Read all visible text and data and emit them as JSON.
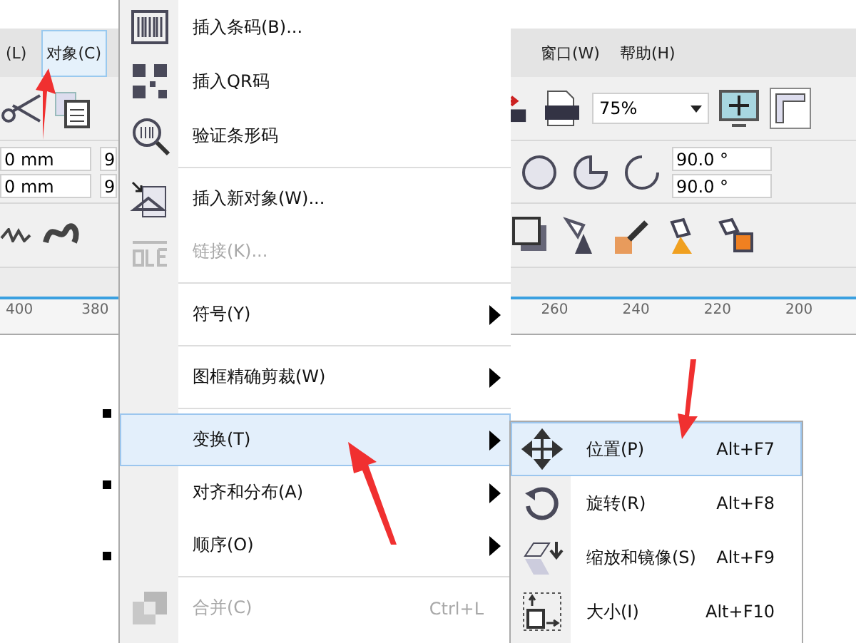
{
  "menubar": {
    "items": [
      {
        "label": "(L)",
        "selected": false
      },
      {
        "label": "对象(C)",
        "selected": true
      },
      {
        "label": "窗口(W)",
        "selected": false
      },
      {
        "label": "帮助(H)",
        "selected": false
      }
    ]
  },
  "toolbar": {
    "zoom": "75%"
  },
  "property_bar": {
    "size_fields": [
      "0 mm",
      "0 mm"
    ],
    "cut_fields": [
      "9",
      "9"
    ],
    "angle_fields": [
      "90.0 °",
      "90.0 °"
    ]
  },
  "ruler": {
    "left_ticks": [
      "400",
      "380"
    ],
    "right_ticks": [
      "260",
      "240",
      "220",
      "200"
    ]
  },
  "menu": {
    "items": [
      {
        "kind": "item",
        "label": "插入条码(B)...",
        "disabled": false,
        "selected": false,
        "submenu": false
      },
      {
        "kind": "item",
        "label": "插入QR码",
        "disabled": false,
        "selected": false,
        "submenu": false
      },
      {
        "kind": "item",
        "label": "验证条形码",
        "disabled": false,
        "selected": false,
        "submenu": false
      },
      {
        "kind": "separator"
      },
      {
        "kind": "item",
        "label": "插入新对象(W)...",
        "disabled": false,
        "selected": false,
        "submenu": false
      },
      {
        "kind": "item",
        "label": "链接(K)...",
        "disabled": true,
        "selected": false,
        "submenu": false
      },
      {
        "kind": "separator"
      },
      {
        "kind": "item",
        "label": "符号(Y)",
        "disabled": false,
        "selected": false,
        "submenu": true
      },
      {
        "kind": "separator"
      },
      {
        "kind": "item",
        "label": "图框精确剪裁(W)",
        "disabled": false,
        "selected": false,
        "submenu": true
      },
      {
        "kind": "separator"
      },
      {
        "kind": "item",
        "label": "变换(T)",
        "disabled": false,
        "selected": true,
        "submenu": true
      },
      {
        "kind": "item",
        "label": "对齐和分布(A)",
        "disabled": false,
        "selected": false,
        "submenu": true
      },
      {
        "kind": "item",
        "label": "顺序(O)",
        "disabled": false,
        "selected": false,
        "submenu": true
      },
      {
        "kind": "separator"
      },
      {
        "kind": "item",
        "label": "合并(C)",
        "shortcut": "Ctrl+L",
        "disabled": true,
        "selected": false,
        "submenu": false
      }
    ]
  },
  "submenu": {
    "items": [
      {
        "label": "位置(P)",
        "shortcut": "Alt+F7",
        "selected": true
      },
      {
        "label": "旋转(R)",
        "shortcut": "Alt+F8",
        "selected": false
      },
      {
        "label": "缩放和镜像(S)",
        "shortcut": "Alt+F9",
        "selected": false
      },
      {
        "label": "大小(I)",
        "shortcut": "Alt+F10",
        "selected": false
      }
    ]
  }
}
